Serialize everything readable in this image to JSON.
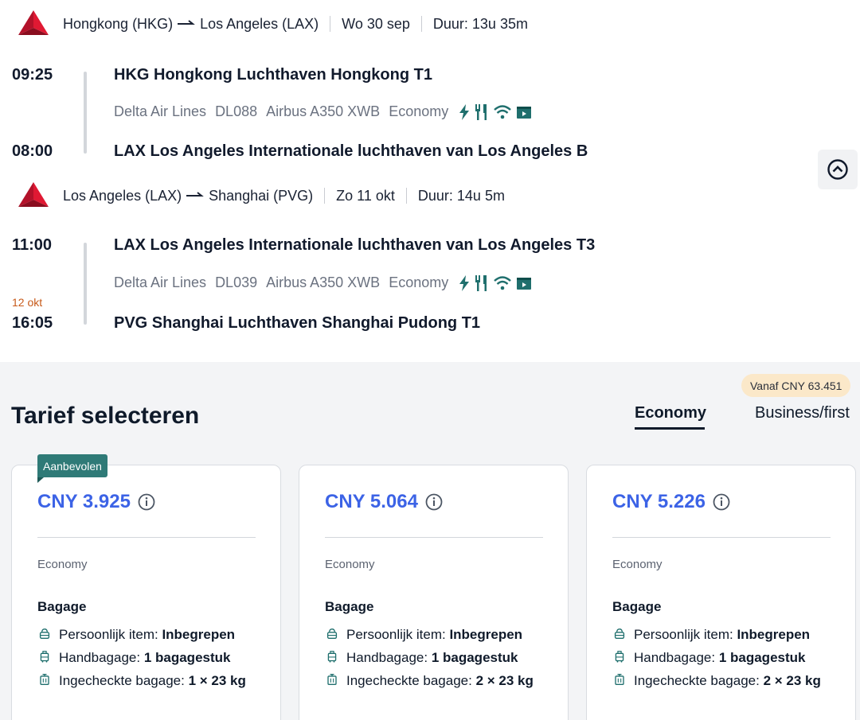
{
  "segments": [
    {
      "route_from": "Hongkong (HKG)",
      "route_to": "Los Angeles (LAX)",
      "date": "Wo 30 sep",
      "duration": "Duur: 13u 35m",
      "dep_time": "09:25",
      "dep_station": "HKG Hongkong Luchthaven Hongkong T1",
      "airline": "Delta Air Lines",
      "flight": "DL088",
      "aircraft": "Airbus A350 XWB",
      "cabin": "Economy",
      "arr_time": "08:00",
      "arr_station": "LAX Los Angeles Internationale luchthaven van Los Angeles B",
      "arr_nextday": ""
    },
    {
      "route_from": "Los Angeles (LAX)",
      "route_to": "Shanghai (PVG)",
      "date": "Zo 11 okt",
      "duration": "Duur: 14u 5m",
      "dep_time": "11:00",
      "dep_station": "LAX Los Angeles Internationale luchthaven van Los Angeles T3",
      "airline": "Delta Air Lines",
      "flight": "DL039",
      "aircraft": "Airbus A350 XWB",
      "cabin": "Economy",
      "arr_time": "16:05",
      "arr_station": "PVG Shanghai Luchthaven Shanghai Pudong T1",
      "arr_nextday": "12 okt"
    }
  ],
  "amenity_icons": [
    "power-icon",
    "meal-icon",
    "wifi-icon",
    "entertainment-icon"
  ],
  "fare": {
    "title": "Tarief selecteren",
    "tabs": {
      "economy": "Economy",
      "business": "Business/first"
    },
    "vanaf": "Vanaf CNY 63.451",
    "badge": "Aanbevolen",
    "cards": [
      {
        "price": "CNY 3.925",
        "cabin": "Economy",
        "bag_title": "Bagage",
        "personal_label": "Persoonlijk item: ",
        "personal_value": "Inbegrepen",
        "hand_label": "Handbagage: ",
        "hand_value": "1 bagagestuk",
        "checked_label": "Ingecheckte bagage: ",
        "checked_value": "1 × 23 kg"
      },
      {
        "price": "CNY 5.064",
        "cabin": "Economy",
        "bag_title": "Bagage",
        "personal_label": "Persoonlijk item: ",
        "personal_value": "Inbegrepen",
        "hand_label": "Handbagage: ",
        "hand_value": "1 bagagestuk",
        "checked_label": "Ingecheckte bagage: ",
        "checked_value": "2 × 23 kg"
      },
      {
        "price": "CNY 5.226",
        "cabin": "Economy",
        "bag_title": "Bagage",
        "personal_label": "Persoonlijk item: ",
        "personal_value": "Inbegrepen",
        "hand_label": "Handbagage: ",
        "hand_value": "1 bagagestuk",
        "checked_label": "Ingecheckte bagage: ",
        "checked_value": "2 × 23 kg"
      }
    ]
  },
  "colors": {
    "price_blue": "#3c63e6",
    "badge_teal": "#2f7a77",
    "delta_red": "#c8102e",
    "nextday_orange": "#c75a1a",
    "amenity_teal": "#1f6f6d"
  }
}
